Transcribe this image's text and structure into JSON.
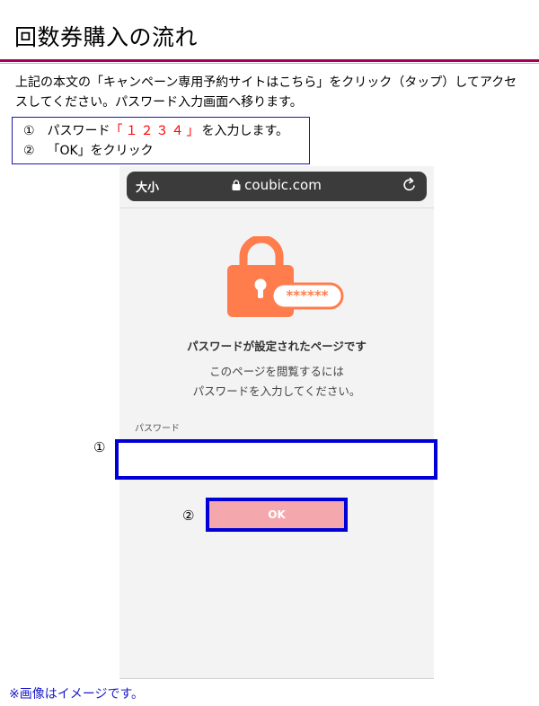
{
  "page": {
    "title": "回数券購入の流れ",
    "intro": "上記の本文の「キャンペーン専用予約サイトはこちら」をクリック（タップ）してアクセスしてください。パスワード入力画面へ移ります。",
    "footnote": "※画像はイメージです。"
  },
  "steps": {
    "step1_num": "①",
    "step1_prefix": "パスワード",
    "step1_password": "「１２３４」",
    "step1_suffix": "を入力します。",
    "step2_num": "②",
    "step2_text": "「OK」をクリック"
  },
  "browser": {
    "text_size_label": "大小",
    "domain": "coubic.com",
    "reload_icon": "reload-icon",
    "lock_icon": "lock-icon"
  },
  "page_content": {
    "masked_password": "******",
    "heading": "パスワードが設定されたページです",
    "desc_line1": "このページを閲覧するには",
    "desc_line2": "パスワードを入力してください。",
    "password_label": "パスワード",
    "password_value": "",
    "ok_label": "OK"
  },
  "markers": {
    "marker1": "①",
    "marker2": "②"
  },
  "colors": {
    "accent_rule": "#a3005a",
    "lock_orange": "#ff7d4d",
    "ok_button": "#f4a7ad",
    "highlight_border": "#0000d6",
    "step_password_red": "#ff0000",
    "footnote_blue": "#1a1acc"
  }
}
